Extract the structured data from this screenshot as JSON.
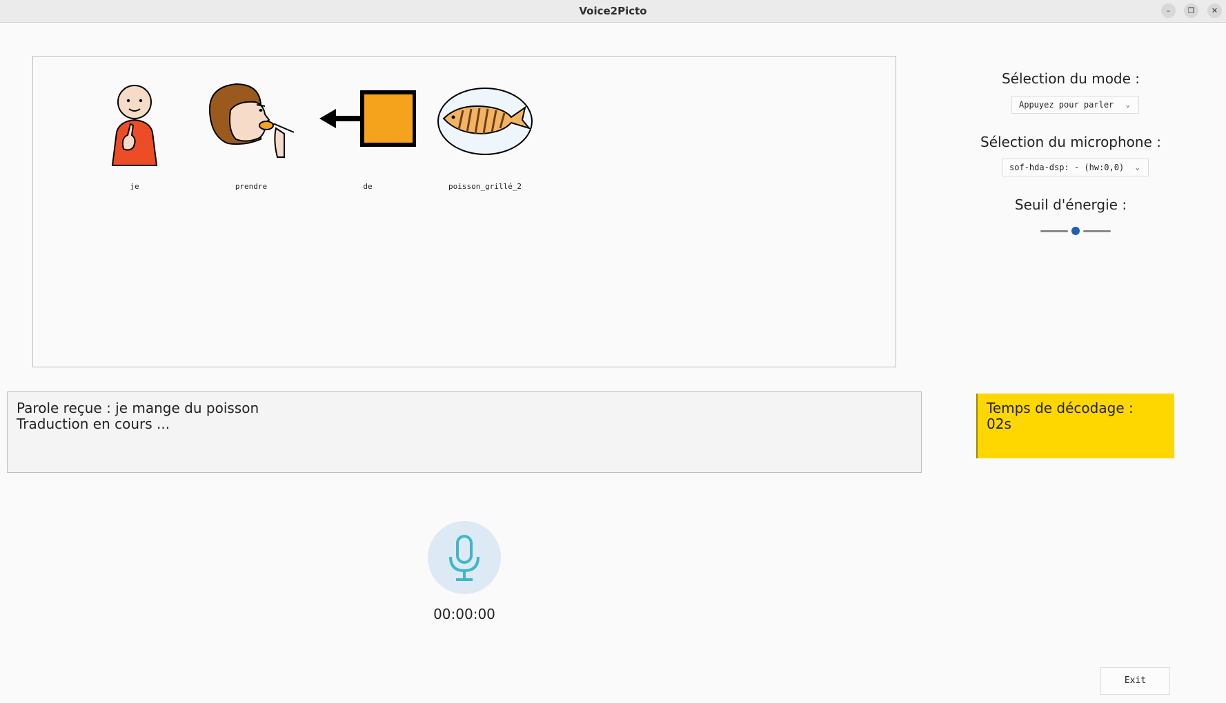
{
  "window": {
    "title": "Voice2Picto",
    "minimize_glyph": "–",
    "restore_glyph": "❐",
    "close_glyph": "✕"
  },
  "pictograms": [
    {
      "label": "je",
      "icon": "person-pointing-self-icon"
    },
    {
      "label": "prendre",
      "icon": "person-eating-icon"
    },
    {
      "label": "de",
      "icon": "arrow-from-square-icon"
    },
    {
      "label": "poisson_grillé_2",
      "icon": "grilled-fish-plate-icon"
    }
  ],
  "status": {
    "line1": "Parole reçue : je mange du poisson",
    "line2": "Traduction en cours ..."
  },
  "settings": {
    "mode_label": "Sélection du mode :",
    "mode_value": "Appuyez pour parler",
    "microphone_label": "Sélection du microphone :",
    "microphone_value": "sof-hda-dsp: - (hw:0,0)",
    "energy_label": "Seuil d'énergie :",
    "energy_level": 0.5
  },
  "decode": {
    "label": "Temps de décodage :",
    "value": "02s"
  },
  "recorder": {
    "timer": "00:00:00",
    "icon": "microphone-icon"
  },
  "exit_label": "Exit",
  "colors": {
    "decode_bg": "#ffd700",
    "mic_bg": "#dde9f5",
    "mic_icon": "#3fb7c6",
    "slider_thumb": "#1f5fb5",
    "picto_orange": "#f5a21c",
    "shirt_red": "#ec4d27"
  }
}
